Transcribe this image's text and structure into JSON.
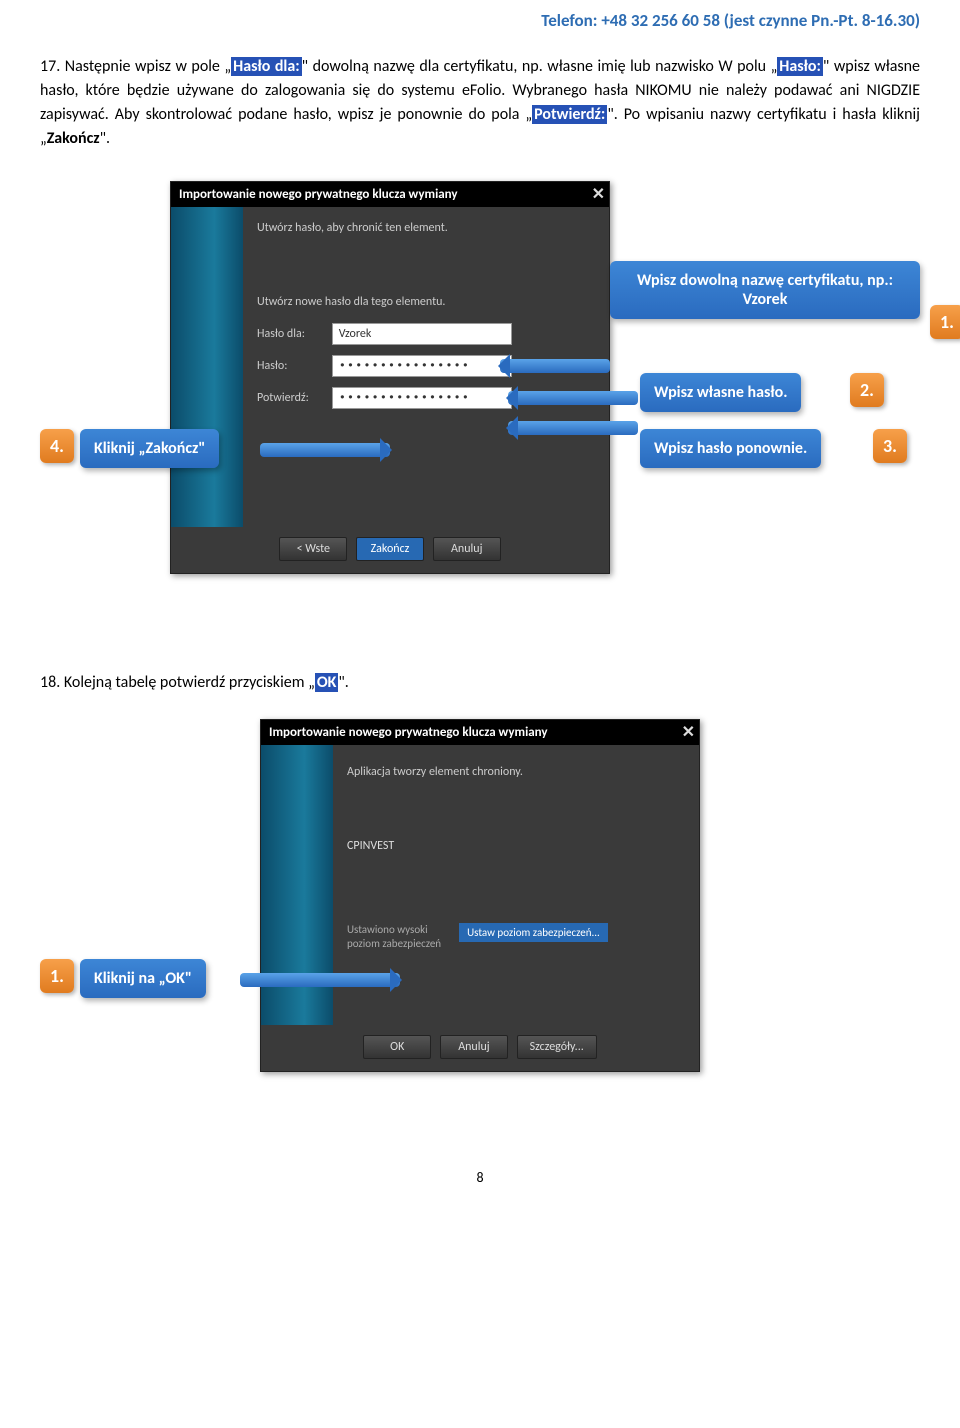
{
  "header": {
    "phone": "Telefon: +48 32 256 60 58 (jest czynne Pn.-Pt. 8-16.30)"
  },
  "para17": {
    "prefix": "17. Następnie wpisz w pole „",
    "haslo_dla": "Hasło dla:",
    "s1": "\" dowolną nazwę dla certyfikatu, np. własne imię lub nazwisko W polu „",
    "haslo": "Hasło:",
    "s2": "\" wpisz własne hasło, które będzie używane do zalogowania się do systemu eFolio. Wybranego hasła NIKOMU nie należy podawać ani NIGDZIE zapisywać. Aby skontrolować podane hasło, wpisz je ponownie do pola „",
    "potwierdz": "Potwierdź:",
    "s3": "\". Po wpisaniu nazwy certyfikatu i hasła kliknij „",
    "zakoncz": "Zakończ",
    "s4": "\"."
  },
  "dialog1": {
    "title": "Importowanie nowego prywatnego klucza wymiany",
    "line1": "Utwórz hasło, aby chronić ten element.",
    "line2": "Utwórz nowe hasło dla tego elementu.",
    "lbl_haslo_dla": "Hasło dla:",
    "val_haslo_dla": "Vzorek",
    "lbl_haslo": "Hasło:",
    "val_haslo": "••••••••••••••••",
    "lbl_potw": "Potwierdź:",
    "val_potw": "••••••••••••••••",
    "btn_back": "< Wste",
    "btn_finish": "Zakończ",
    "btn_cancel": "Anuluj"
  },
  "callouts1": {
    "c1a": "Wpisz dowolną nazwę certyfikatu, np.:",
    "c1b": "Vzorek",
    "n1": "1.",
    "c2": "Wpisz własne hasło.",
    "n2": "2.",
    "c3": "Wpisz hasło ponownie.",
    "n3": "3.",
    "c4": "Kliknij „Zakończ\"",
    "n4": "4."
  },
  "para18": {
    "prefix": "18. Kolejną tabelę potwierdź przyciskiem „",
    "ok": "OK",
    "suffix": "\"."
  },
  "dialog2": {
    "title": "Importowanie nowego prywatnego klucza wymiany",
    "line1": "Aplikacja tworzy element chroniony.",
    "cp": "CPINVEST",
    "sub1": "Ustawiono wysoki",
    "sub2": "poziom zabezpieczeń",
    "btn_ustaw": "Ustaw poziom zabezpieczeń...",
    "btn_ok": "OK",
    "btn_cancel": "Anuluj",
    "btn_details": "Szczegóły..."
  },
  "callouts2": {
    "c1": "Kliknij na „OK\"",
    "n1": "1."
  },
  "page": "8"
}
